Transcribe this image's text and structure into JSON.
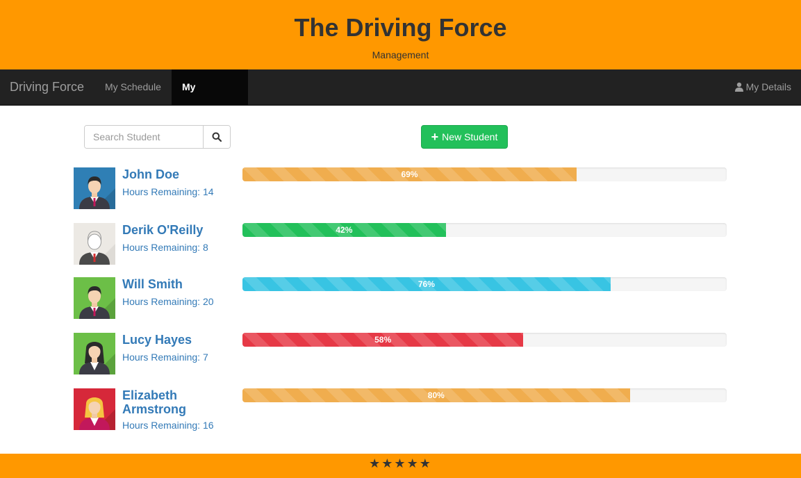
{
  "header": {
    "title": "The Driving Force",
    "subtitle": "Management"
  },
  "navbar": {
    "brand": "Driving Force",
    "items": [
      {
        "label": "My Schedule",
        "active": false
      },
      {
        "label": "My Students",
        "active": true
      }
    ],
    "right": {
      "label": "My Details",
      "icon": "user-icon"
    }
  },
  "toolbar": {
    "search_placeholder": "Search Student",
    "search_value": "",
    "search_icon": "search-icon",
    "new_student_label": "New Student",
    "new_student_icon": "plus-icon"
  },
  "students": [
    {
      "name": "John Doe",
      "hours": "Hours Remaining: 14",
      "progress": 69,
      "progress_label": "69%",
      "color": "#f0ad4e",
      "avatar_bg": "#2f7fb5",
      "avatar_icon": "male-student-avatar-icon"
    },
    {
      "name": "Derik O'Reilly",
      "hours": "Hours Remaining: 8",
      "progress": 42,
      "progress_label": "42%",
      "color": "#22c05a",
      "avatar_bg": "#ece9e4",
      "avatar_icon": "male-outline-avatar-icon"
    },
    {
      "name": "Will Smith",
      "hours": "Hours Remaining: 20",
      "progress": 76,
      "progress_label": "76%",
      "color": "#38c4e3",
      "avatar_bg": "#6cbf47",
      "avatar_icon": "male-student-avatar-icon"
    },
    {
      "name": "Lucy Hayes",
      "hours": "Hours Remaining: 7",
      "progress": 58,
      "progress_label": "58%",
      "color": "#e63946",
      "avatar_bg": "#6cbf47",
      "avatar_icon": "female-student-avatar-icon"
    },
    {
      "name": "Elizabeth Armstrong",
      "hours": "Hours Remaining: 16",
      "progress": 80,
      "progress_label": "80%",
      "color": "#f0ad4e",
      "avatar_bg": "#d6283a",
      "avatar_icon": "female-blonde-avatar-icon"
    }
  ],
  "footer": {
    "stars": "★★★★★"
  }
}
